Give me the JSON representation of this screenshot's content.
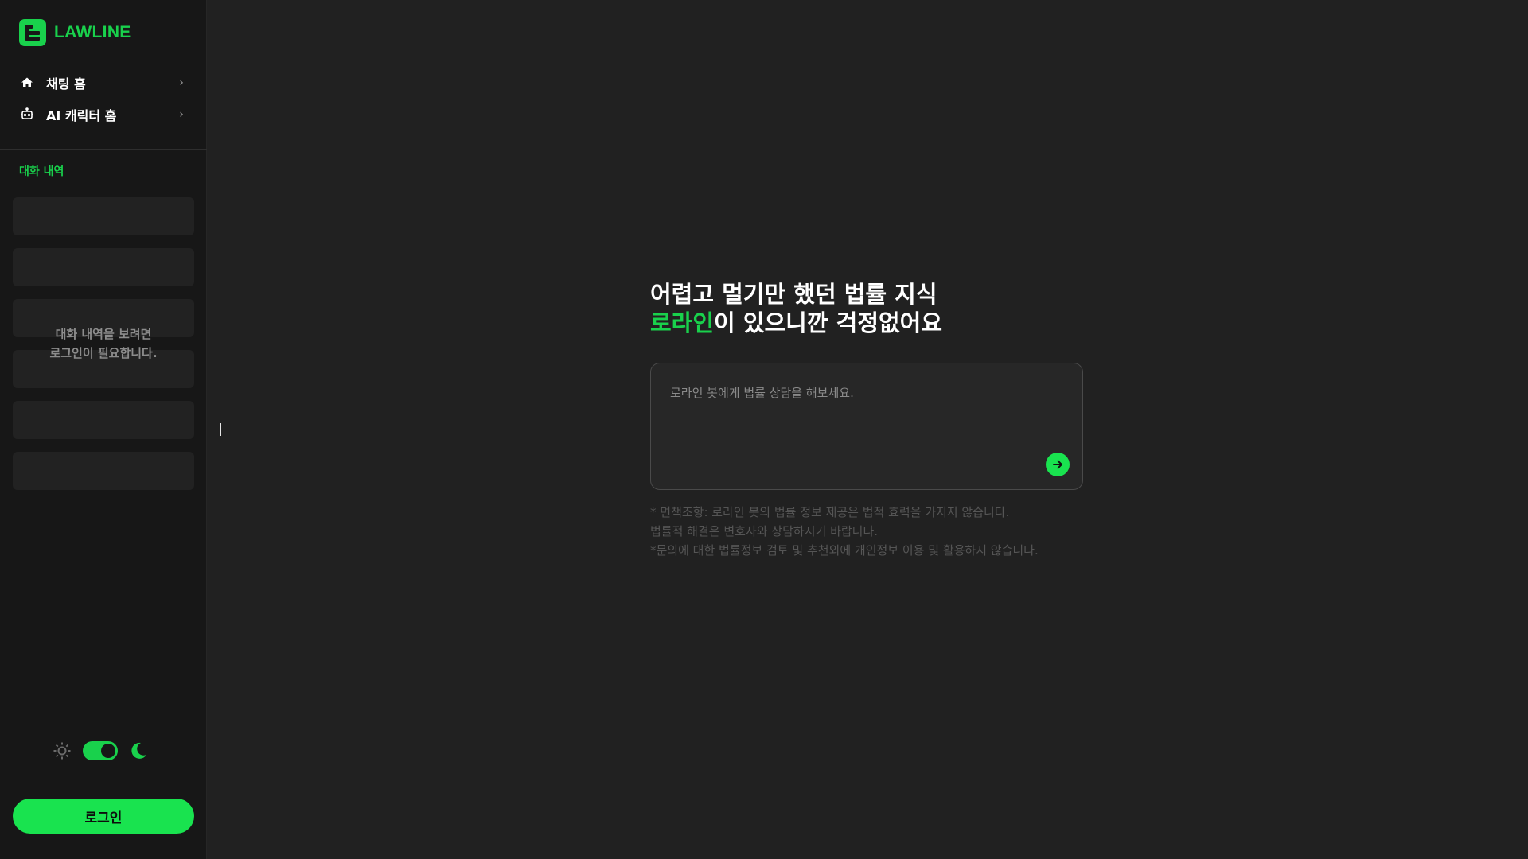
{
  "brand": {
    "name": "LAWLINE",
    "color": "#19d14c"
  },
  "sidebar": {
    "nav": [
      {
        "label": "채팅 홈",
        "icon": "home-icon"
      },
      {
        "label": "AI 캐릭터 홈",
        "icon": "robot-icon"
      }
    ],
    "history_title": "대화 내역",
    "history_message_line1": "대화 내역을 보려면",
    "history_message_line2": "로그인이 필요합니다.",
    "theme_toggle": {
      "state": "dark",
      "light_icon": "sun-icon",
      "dark_icon": "moon-icon"
    },
    "login_label": "로그인"
  },
  "main": {
    "hero_line1": "어렵고 멀기만 했던 법률 지식",
    "hero_accent": "로라인",
    "hero_line2_rest": "이 있으니깐 걱정없어요",
    "prompt_placeholder": "로라인 봇에게 법률 상담을 해보세요.",
    "send_icon": "arrow-right-icon",
    "disclaimer_line1": "* 면책조항: 로라인 봇의 법률 정보 제공은 법적 효력을 가지지 않습니다.",
    "disclaimer_line2": "법률적 해결은 변호사와 상담하시기 바랍니다.",
    "disclaimer_line3": "*문의에 대한 법률정보 검토 및 추천외에 개인정보 이용 및 활용하지 않습니다."
  }
}
